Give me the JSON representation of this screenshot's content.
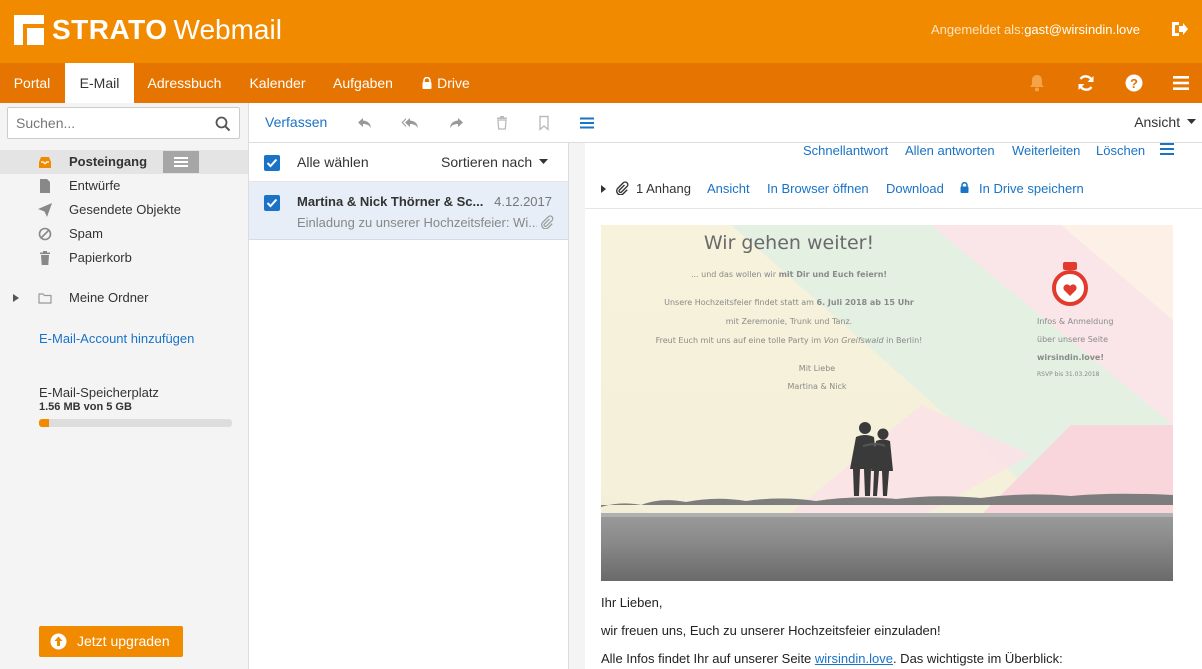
{
  "app": {
    "brand": "STRATO",
    "product": "Webmail",
    "user_label": "Angemeldet als:",
    "user_email": "gast@wirsindin.love"
  },
  "nav": {
    "items": [
      {
        "label": "Portal"
      },
      {
        "label": "E-Mail"
      },
      {
        "label": "Adressbuch"
      },
      {
        "label": "Kalender"
      },
      {
        "label": "Aufgaben"
      },
      {
        "label": "Drive"
      }
    ],
    "active": "E-Mail"
  },
  "search": {
    "placeholder": "Suchen..."
  },
  "folders": [
    {
      "label": "Posteingang",
      "icon": "inbox-icon"
    },
    {
      "label": "Entwürfe",
      "icon": "document-icon"
    },
    {
      "label": "Gesendete Objekte",
      "icon": "send-icon"
    },
    {
      "label": "Spam",
      "icon": "spam-icon"
    },
    {
      "label": "Papierkorb",
      "icon": "trash-icon"
    },
    {
      "label": "Meine Ordner",
      "icon": "folder-icon"
    }
  ],
  "sidebar": {
    "add_account": "E-Mail-Account hinzufügen",
    "storage_label": "E-Mail-Speicherplatz",
    "storage_value": "1.56 MB von 5 GB",
    "storage_fraction": 0.05,
    "upgrade": "Jetzt upgraden"
  },
  "toolbar": {
    "compose": "Verfassen",
    "view": "Ansicht"
  },
  "list": {
    "select_all": "Alle wählen",
    "sort": "Sortieren nach",
    "mails": [
      {
        "from": "Martina & Nick Thörner & Sc...",
        "date": "4.12.2017",
        "subject": "Einladung zu unserer Hochzeitsfeier: Wi..."
      }
    ]
  },
  "reader": {
    "actions": [
      "Schnellantwort",
      "Allen antworten",
      "Weiterleiten",
      "Löschen"
    ],
    "attachment_count": "1 Anhang",
    "attachment_actions": [
      "Ansicht",
      "In Browser öffnen",
      "Download",
      "In Drive speichern"
    ],
    "invite": {
      "headline": "Wir gehen weiter!",
      "line1_a": "... und das wollen wir ",
      "line1_b": "mit Dir und Euch feiern!",
      "line2_a": "Unsere Hochzeitsfeier findet statt am ",
      "line2_b": "6. Juli 2018 ab 15 Uhr",
      "line3": "mit Zeremonie, Trunk und Tanz.",
      "line4_a": "Freut Euch mit uns auf eine tolle Party im ",
      "line4_b": "Von Greifswald",
      "line4_c": " in Berlin!",
      "closing": "Mit Liebe",
      "names": "Martina & Nick",
      "side1": "Infos & Anmeldung",
      "side2": "über unsere Seite",
      "side3": "wirsindin.love!",
      "side4": "RSVP bis 31.03.2018"
    },
    "body_greeting": "Ihr Lieben,",
    "body_line1": "wir freuen uns, Euch zu unserer Hochzeitsfeier einzuladen!",
    "body_line2_a": "Alle Infos findet Ihr auf unserer Seite ",
    "body_line2_link": "wirsindin.love",
    "body_line2_b": ". Das wichtigste im Überblick:"
  },
  "colors": {
    "brand_orange": "#f28a00",
    "nav_orange": "#e67400",
    "link_blue": "#1a73c6"
  }
}
